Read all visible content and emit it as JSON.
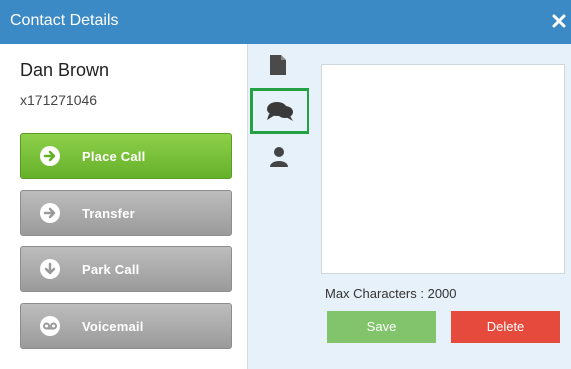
{
  "window": {
    "title": "Contact Details"
  },
  "contact": {
    "name": "Dan Brown",
    "extension": "x171271046"
  },
  "actions": [
    {
      "label": "Place Call",
      "icon": "arrow-right-circle-icon"
    },
    {
      "label": "Transfer",
      "icon": "arrow-right-icon"
    },
    {
      "label": "Park Call",
      "icon": "arrow-down-icon"
    },
    {
      "label": "Voicemail",
      "icon": "voicemail-icon"
    }
  ],
  "tabs": [
    {
      "icon": "document-icon",
      "active": false
    },
    {
      "icon": "chat-icon",
      "active": true
    },
    {
      "icon": "user-icon",
      "active": false
    }
  ],
  "notes": {
    "value": "",
    "max_chars_label": "Max Characters : 2000",
    "save_label": "Save",
    "delete_label": "Delete"
  },
  "colors": {
    "titlebar": "#3b8ac6",
    "place_call": "#7bc23a",
    "gray_button": "#a8a8a8",
    "active_tab_border": "#23a143",
    "save": "#81c46c",
    "delete": "#e64a3c",
    "panel_bg": "#e6f1f9"
  }
}
